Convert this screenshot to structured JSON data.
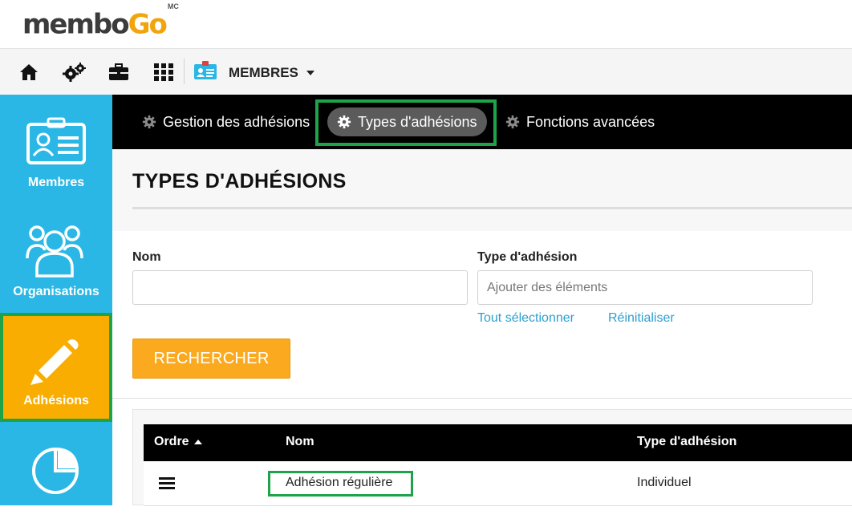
{
  "brand": {
    "name_part1": "membo",
    "name_part2": "Go",
    "mark": "MC"
  },
  "toolbar": {
    "icons": [
      "home-icon",
      "gears-icon",
      "briefcase-icon",
      "grid-icon",
      "member-card-icon"
    ],
    "module_label": "MEMBRES"
  },
  "sidebar": {
    "items": [
      {
        "label": "Membres",
        "icon": "id-card-icon"
      },
      {
        "label": "Organisations",
        "icon": "users-group-icon"
      },
      {
        "label": "Adhésions",
        "icon": "pencil-icon",
        "active": true
      },
      {
        "label": "",
        "icon": "pie-chart-icon"
      }
    ]
  },
  "subnav": {
    "tabs": [
      {
        "label": "Gestion des adhésions"
      },
      {
        "label": "Types d'adhésions",
        "active": true
      },
      {
        "label": "Fonctions avancées"
      }
    ]
  },
  "page": {
    "title": "TYPES D'ADHÉSIONS"
  },
  "form": {
    "nom_label": "Nom",
    "nom_value": "",
    "type_label": "Type d'adhésion",
    "type_placeholder": "Ajouter des éléments",
    "select_all": "Tout sélectionner",
    "reset": "Réinitialiser",
    "search_button": "RECHERCHER"
  },
  "table": {
    "headers": {
      "order": "Ordre",
      "name": "Nom",
      "type": "Type d'adhésion"
    },
    "rows": [
      {
        "name": "Adhésion régulière",
        "type": "Individuel"
      }
    ]
  },
  "colors": {
    "sidebar": "#2bb7e5",
    "active": "#f8ad00",
    "highlight": "#1fa34a",
    "button": "#fbaa1f",
    "link": "#2c9fd0"
  }
}
